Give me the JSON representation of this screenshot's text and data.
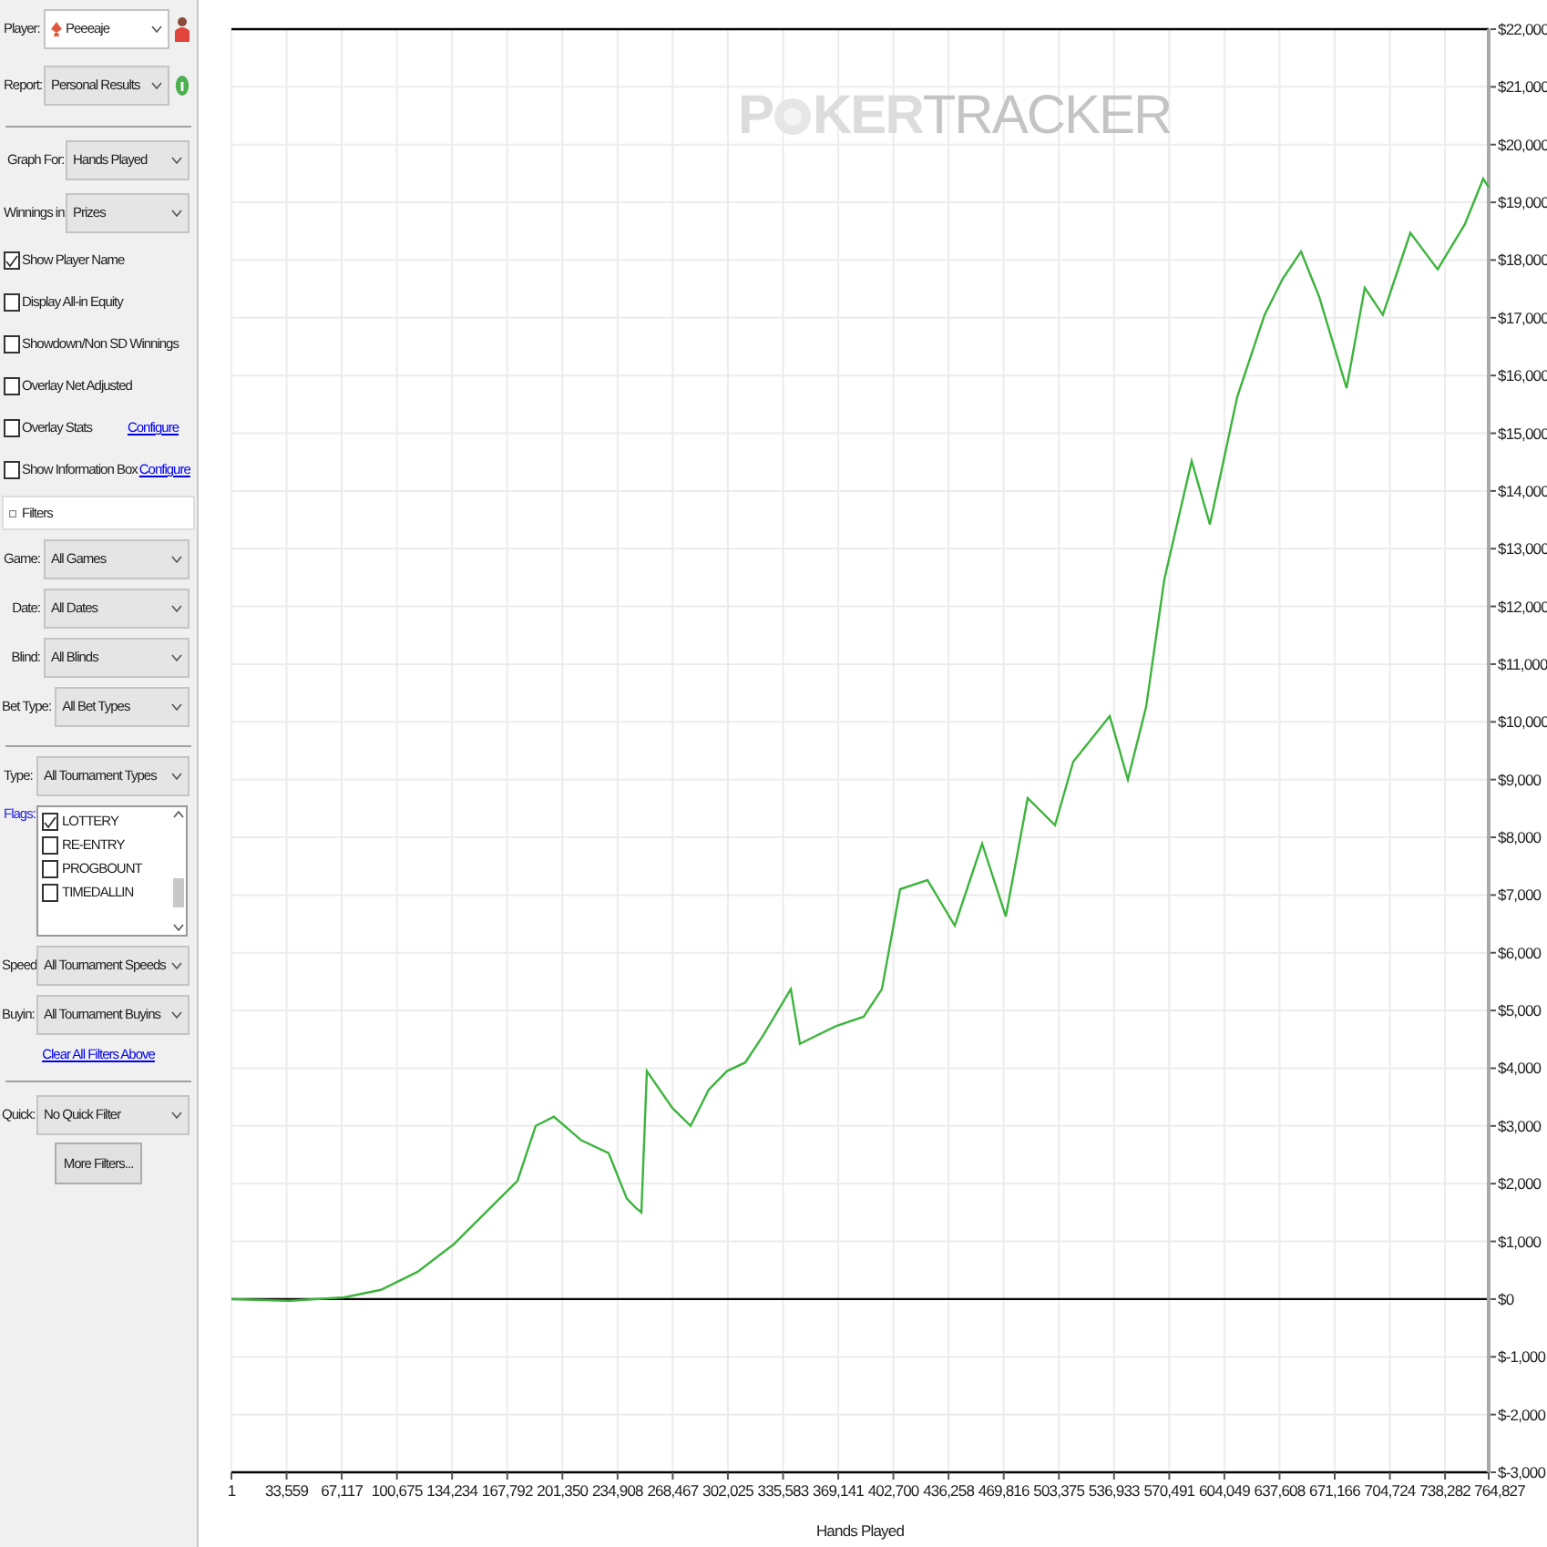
{
  "sidebar": {
    "player": {
      "label": "Player:",
      "value": "Peeeaje"
    },
    "report": {
      "label": "Report:",
      "value": "Personal Results"
    },
    "graph_for": {
      "label": "Graph For:",
      "value": "Hands Played"
    },
    "winnings_in": {
      "label": "Winnings in:",
      "value": "Prizes"
    },
    "options": [
      {
        "label": "Show Player Name",
        "checked": true
      },
      {
        "label": "Display All-in Equity",
        "checked": false
      },
      {
        "label": "Showdown/Non SD Winnings",
        "checked": false
      },
      {
        "label": "Overlay Net Adjusted",
        "checked": false
      },
      {
        "label": "Overlay Stats",
        "checked": false,
        "link": "Configure"
      },
      {
        "label": "Show Information Box",
        "checked": false,
        "link": "Configure"
      }
    ],
    "filters_header": "Filters",
    "filters": [
      {
        "label": "Game:",
        "value": "All Games"
      },
      {
        "label": "Date:",
        "value": "All Dates"
      },
      {
        "label": "Blind:",
        "value": "All Blinds"
      },
      {
        "label": "Bet Type:",
        "value": "All Bet Types"
      }
    ],
    "type": {
      "label": "Type:",
      "value": "All Tournament Types"
    },
    "flags": {
      "label": "Flags:",
      "items": [
        {
          "label": "LOTTERY",
          "checked": true
        },
        {
          "label": "RE-ENTRY",
          "checked": false
        },
        {
          "label": "PROGBOUNT",
          "checked": false
        },
        {
          "label": "TIMEDALLIN",
          "checked": false
        }
      ]
    },
    "speed": {
      "label": "Speed:",
      "value": "All Tournament Speeds"
    },
    "buyin": {
      "label": "Buyin:",
      "value": "All Tournament Buyins"
    },
    "clear_link": "Clear All Filters Above",
    "quick": {
      "label": "Quick:",
      "value": "No Quick Filter"
    },
    "more_button": "More Filters..."
  },
  "watermark": {
    "left": "P",
    "middle": "KER",
    "right": "TRACKER"
  },
  "chart": {
    "chart_data": {
      "type": "line",
      "grid": true,
      "xlabel": "Hands Played",
      "xlim": [
        1,
        764827
      ],
      "ylim": [
        -3000,
        22000
      ],
      "xticks": [
        {
          "value": 1,
          "label": "1"
        },
        {
          "value": 33559,
          "label": "33,559"
        },
        {
          "value": 67117,
          "label": "67,117"
        },
        {
          "value": 100675,
          "label": "100,675"
        },
        {
          "value": 134234,
          "label": "134,234"
        },
        {
          "value": 167792,
          "label": "167,792"
        },
        {
          "value": 201350,
          "label": "201,350"
        },
        {
          "value": 234908,
          "label": "234,908"
        },
        {
          "value": 268467,
          "label": "268,467"
        },
        {
          "value": 302025,
          "label": "302,025"
        },
        {
          "value": 335583,
          "label": "335,583"
        },
        {
          "value": 369141,
          "label": "369,141"
        },
        {
          "value": 402700,
          "label": "402,700"
        },
        {
          "value": 436258,
          "label": "436,258"
        },
        {
          "value": 469816,
          "label": "469,816"
        },
        {
          "value": 503375,
          "label": "503,375"
        },
        {
          "value": 536933,
          "label": "536,933"
        },
        {
          "value": 570491,
          "label": "570,491"
        },
        {
          "value": 604049,
          "label": "604,049"
        },
        {
          "value": 637608,
          "label": "637,608"
        },
        {
          "value": 671166,
          "label": "671,166"
        },
        {
          "value": 704724,
          "label": "704,724"
        },
        {
          "value": 738282,
          "label": "738,282"
        },
        {
          "value": 764827,
          "label": "764,827"
        }
      ],
      "yticks": [
        {
          "value": 22000,
          "label": "$22,000"
        },
        {
          "value": 21000,
          "label": "$21,000"
        },
        {
          "value": 20000,
          "label": "$20,000"
        },
        {
          "value": 19000,
          "label": "$19,000"
        },
        {
          "value": 18000,
          "label": "$18,000"
        },
        {
          "value": 17000,
          "label": "$17,000"
        },
        {
          "value": 16000,
          "label": "$16,000"
        },
        {
          "value": 15000,
          "label": "$15,000"
        },
        {
          "value": 14000,
          "label": "$14,000"
        },
        {
          "value": 13000,
          "label": "$13,000"
        },
        {
          "value": 12000,
          "label": "$12,000"
        },
        {
          "value": 11000,
          "label": "$11,000"
        },
        {
          "value": 10000,
          "label": "$10,000"
        },
        {
          "value": 9000,
          "label": "$9,000"
        },
        {
          "value": 8000,
          "label": "$8,000"
        },
        {
          "value": 7000,
          "label": "$7,000"
        },
        {
          "value": 6000,
          "label": "$6,000"
        },
        {
          "value": 5000,
          "label": "$5,000"
        },
        {
          "value": 4000,
          "label": "$4,000"
        },
        {
          "value": 3000,
          "label": "$3,000"
        },
        {
          "value": 2000,
          "label": "$2,000"
        },
        {
          "value": 1000,
          "label": "$1,000"
        },
        {
          "value": 0,
          "label": "$0"
        },
        {
          "value": -1000,
          "label": "$-1,000"
        },
        {
          "value": -2000,
          "label": "$-2,000"
        },
        {
          "value": -3000,
          "label": "$-3,000"
        }
      ],
      "x": [
        1,
        35470,
        68720,
        90890,
        113060,
        135230,
        157390,
        174020,
        185100,
        196190,
        212810,
        229440,
        240520,
        246060,
        249390,
        252720,
        268240,
        279320,
        290410,
        301490,
        312580,
        323660,
        340290,
        345830,
        356900,
        367990,
        384620,
        395700,
        406780,
        423410,
        440040,
        456660,
        471070,
        484370,
        501000,
        512080,
        534240,
        545330,
        556410,
        567490,
        584120,
        595200,
        611820,
        628450,
        639530,
        650610,
        661700,
        678320,
        689400,
        700480,
        717110,
        733740,
        750360,
        761450,
        764827
      ],
      "series": [
        {
          "color": "#3cb43c",
          "values": [
            0,
            -30,
            30,
            160,
            470,
            950,
            1580,
            2050,
            3000,
            3160,
            2750,
            2530,
            1740,
            1580,
            1500,
            3950,
            3310,
            3000,
            3630,
            3950,
            4100,
            4580,
            5370,
            4420,
            4580,
            4730,
            4890,
            5370,
            7100,
            7260,
            6470,
            7890,
            6630,
            8680,
            8210,
            9310,
            10100,
            9000,
            10260,
            12470,
            14520,
            13420,
            15630,
            17050,
            17680,
            18150,
            17360,
            15780,
            17520,
            17050,
            18470,
            17840,
            18620,
            19410,
            19260
          ]
        }
      ]
    }
  }
}
